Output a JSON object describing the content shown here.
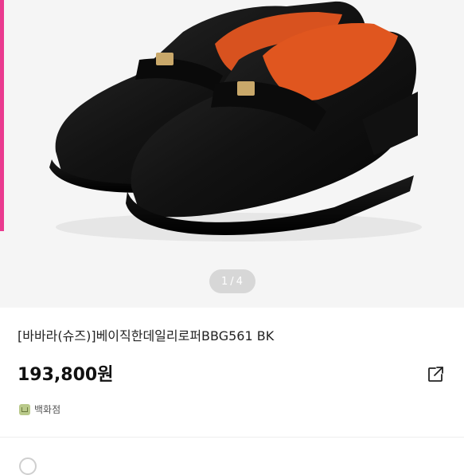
{
  "product": {
    "title": "[바바라(슈즈)]베이직한데일리로퍼BBG561 BK",
    "price": "193,800원",
    "badge": "백화점"
  },
  "pager": {
    "current": "1",
    "total": "4"
  },
  "icons": {
    "share": "share-icon",
    "dept": "department-store-icon"
  },
  "colors": {
    "accent": "#ea3a8f",
    "badge": "#b9c98a",
    "image_bg": "#f5f5f5"
  }
}
